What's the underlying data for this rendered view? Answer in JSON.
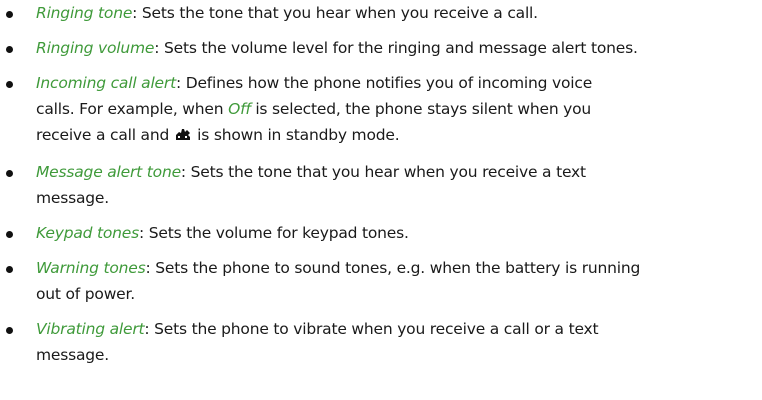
{
  "colors": {
    "term": "#3f9a3a",
    "text": "#1a1a1a"
  },
  "items": [
    {
      "term": "Ringing tone",
      "lines": [
        ": Sets the tone that you hear when you receive a call."
      ]
    },
    {
      "term": "Ringing volume",
      "lines": [
        ": Sets the volume level for the ringing and message alert tones."
      ]
    },
    {
      "term": "Incoming call alert",
      "line1": ": Defines how the phone notifies you of incoming voice",
      "line2_pre": "calls. For example, when ",
      "inline_term": "Off",
      "line2_post": " is selected, the phone stays silent when you",
      "line3_pre": "receive a call and",
      "line3_icon": "silent-mode-icon",
      "line3_post": "is shown in standby mode."
    },
    {
      "term": "Message alert tone",
      "lines": [
        ": Sets the tone that you hear when you receive a text",
        "message."
      ]
    },
    {
      "term": "Keypad tones",
      "lines": [
        ": Sets the volume for keypad tones."
      ]
    },
    {
      "term": "Warning tones",
      "lines": [
        ": Sets the phone to sound tones, e.g. when the battery is running",
        "out of power."
      ]
    },
    {
      "term": "Vibrating alert",
      "lines": [
        ": Sets the phone to vibrate when you receive a call or a text",
        "message."
      ]
    }
  ]
}
